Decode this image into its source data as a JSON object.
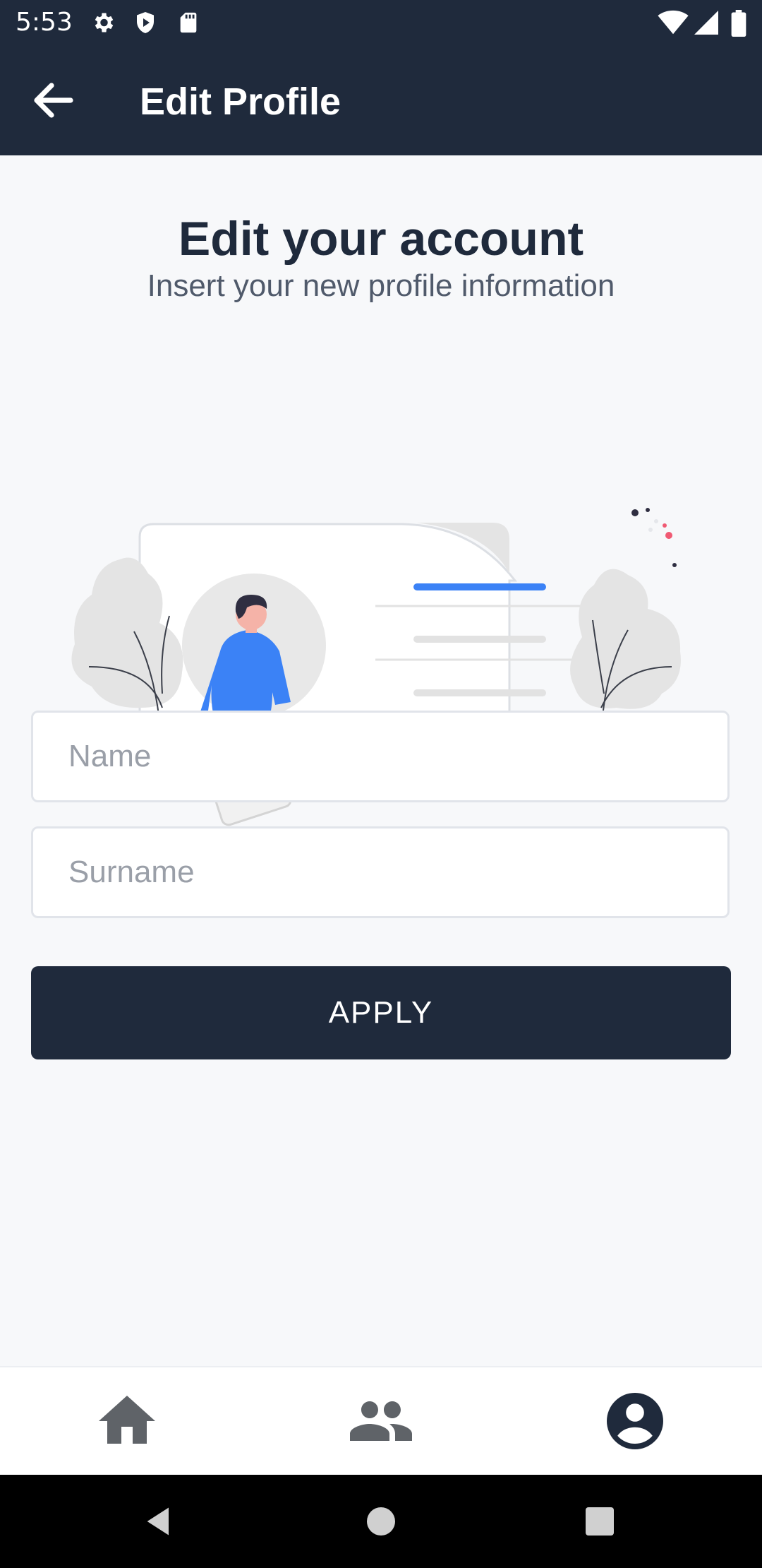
{
  "status_bar": {
    "time": "5:53",
    "icons": [
      "gear-icon",
      "shield-icon",
      "sd-card-icon",
      "wifi-icon",
      "signal-icon",
      "battery-icon"
    ]
  },
  "app_bar": {
    "title": "Edit Profile",
    "back_icon": "arrow-left-icon"
  },
  "content": {
    "heading": "Edit your account",
    "subheading": "Insert your new profile information",
    "fields": {
      "name_placeholder": "Name",
      "surname_placeholder": "Surname"
    },
    "apply_label": "APPLY"
  },
  "bottom_nav": {
    "items": [
      "home-icon",
      "people-icon",
      "account-circle-icon"
    ],
    "active": "account-circle-icon"
  },
  "system_nav": [
    "back-triangle-icon",
    "home-circle-icon",
    "recents-square-icon"
  ],
  "colors": {
    "primary": "#1f2a3c",
    "accent": "#3b82f6",
    "background": "#f7f8fa"
  }
}
